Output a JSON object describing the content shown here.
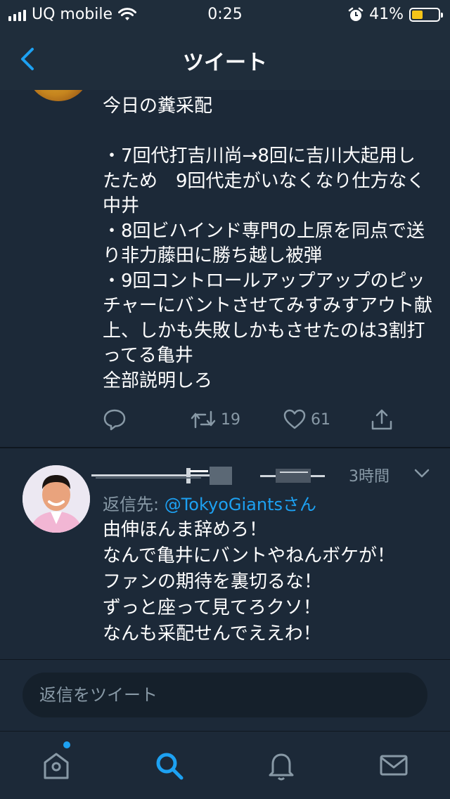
{
  "status_bar": {
    "carrier": "UQ mobile",
    "time": "0:25",
    "battery_pct": "41%",
    "battery_level": 0.41,
    "battery_color": "#f5c518"
  },
  "nav": {
    "title": "ツイート",
    "back_icon": "chevron-left-icon"
  },
  "tweet": {
    "text": "今日の糞采配\n\n・7回代打吉川尚→8回に吉川大起用したため　9回代走がいなくなり仕方なく中井\n・8回ビハインド専門の上原を同点で送り非力藤田に勝ち越し被弾\n・9回コントロールアップアップのピッチャーにバントさせてみすみすアウト献上、しかも失敗しかもさせたのは3割打ってる亀井\n全部説明しろ",
    "retweets": "19",
    "likes": "61"
  },
  "reply": {
    "time": "3時間",
    "reply_to_prefix": "返信先: ",
    "reply_to_handle": "@TokyoGiants",
    "reply_to_suffix": "さん",
    "text": "由伸ほんま辞めろ！\nなんで亀井にバントやねんボケが！\nファンの期待を裏切るな！\nずっと座って見てろクソ！\nなんも采配せんでええわ！"
  },
  "compose": {
    "placeholder": "返信をツイート"
  },
  "tab_bar": {
    "items": [
      "home-icon",
      "search-icon",
      "notifications-icon",
      "messages-icon"
    ],
    "active": "search-icon"
  },
  "colors": {
    "background": "#15202b",
    "card": "#1c2938",
    "accent": "#1da1f2",
    "muted": "#8899a6"
  }
}
